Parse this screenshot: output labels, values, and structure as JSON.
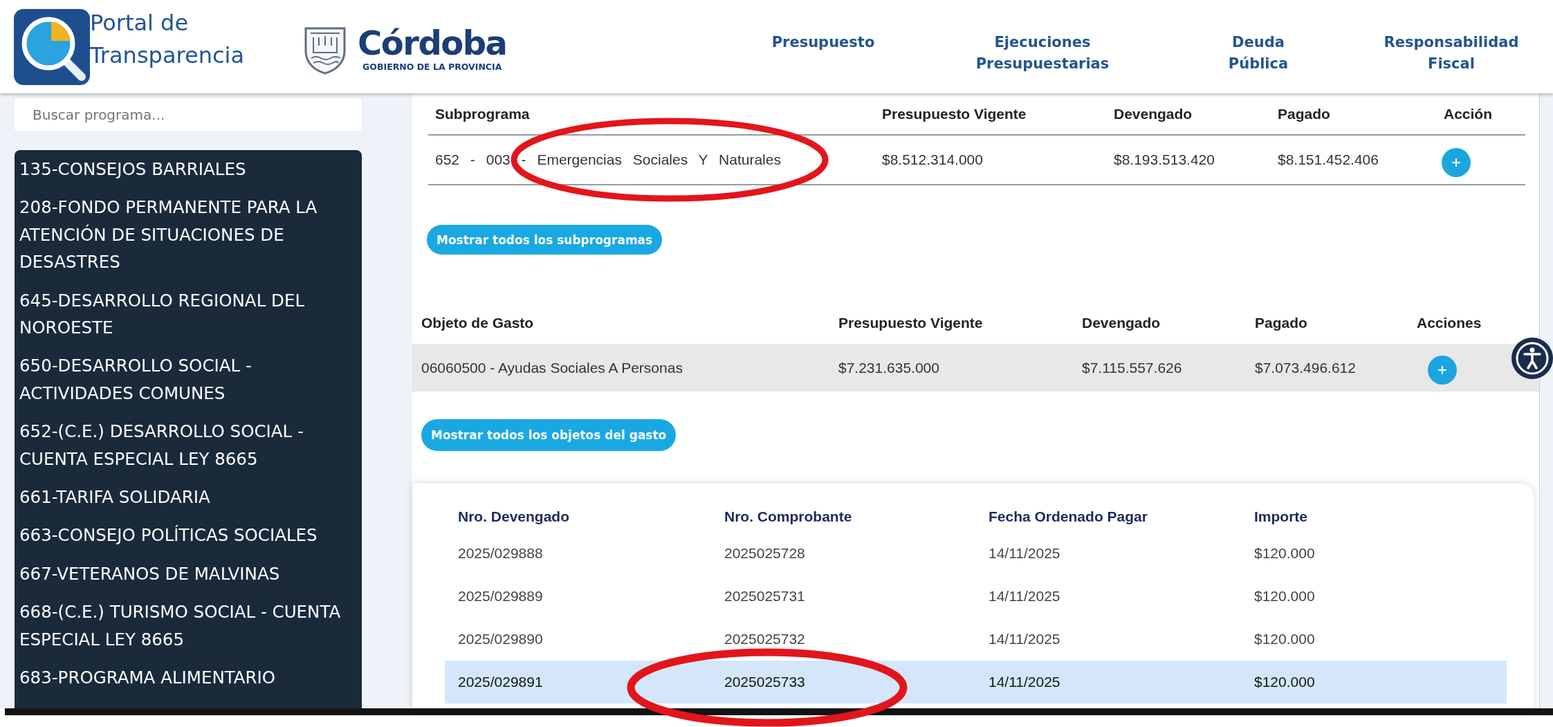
{
  "header": {
    "portal_title": "Portal de Transparencia",
    "brand_name": "Córdoba",
    "brand_subtitle": "GOBIERNO DE LA PROVINCIA",
    "nav": [
      {
        "label": "Presupuesto"
      },
      {
        "label": "Ejecuciones Presupuestarias"
      },
      {
        "label": "Deuda Pública"
      },
      {
        "label": "Responsabilidad Fiscal"
      }
    ]
  },
  "sidebar": {
    "search": {
      "placeholder": "Buscar programa..."
    },
    "programs": [
      "135-CONSEJOS BARRIALES",
      "208-FONDO PERMANENTE PARA LA ATENCIÓN DE SITUACIONES DE DESASTRES",
      "645-DESARROLLO REGIONAL DEL NOROESTE",
      "650-DESARROLLO SOCIAL - ACTIVIDADES COMUNES",
      "652-(C.E.) DESARROLLO SOCIAL - CUENTA ESPECIAL LEY 8665",
      "661-TARIFA SOLIDARIA",
      "663-CONSEJO POLÍTICAS SOCIALES",
      "667-VETERANOS DE MALVINAS",
      "668-(C.E.) TURISMO SOCIAL - CUENTA ESPECIAL LEY 8665",
      "683-PROGRAMA ALIMENTARIO"
    ]
  },
  "subprogram_table": {
    "columns": [
      "Subprograma",
      "Presupuesto Vigente",
      "Devengado",
      "Pagado",
      "Acción"
    ],
    "rows": [
      {
        "cells": [
          "652 - 003 - Emergencias Sociales Y Naturales",
          "$8.512.314.000",
          "$8.193.513.420",
          "$8.151.452.406"
        ],
        "circled": true
      }
    ],
    "show_all_button": "Mostrar todos los subprogramas"
  },
  "expense_table": {
    "columns": [
      "Objeto de Gasto",
      "Presupuesto Vigente",
      "Devengado",
      "Pagado",
      "Acciones"
    ],
    "rows": [
      {
        "cells": [
          "06060500 - Ayudas Sociales A Personas",
          "$7.231.635.000",
          "$7.115.557.626",
          "$7.073.496.612"
        ]
      }
    ],
    "show_all_button": "Mostrar todos los objetos del gasto"
  },
  "accruals_table": {
    "columns": [
      "Nro. Devengado",
      "Nro. Comprobante",
      "Fecha Ordenado Pagar",
      "Importe"
    ],
    "rows": [
      {
        "cells": [
          "2025/029888",
          "2025025728",
          "14/11/2025",
          "$120.000"
        ],
        "selected": false,
        "circled": false
      },
      {
        "cells": [
          "2025/029889",
          "2025025731",
          "14/11/2025",
          "$120.000"
        ],
        "selected": false,
        "circled": false
      },
      {
        "cells": [
          "2025/029890",
          "2025025732",
          "14/11/2025",
          "$120.000"
        ],
        "selected": false,
        "circled": false
      },
      {
        "cells": [
          "2025/029891",
          "2025025733",
          "14/11/2025",
          "$120.000"
        ],
        "selected": true,
        "circled": true
      }
    ]
  }
}
